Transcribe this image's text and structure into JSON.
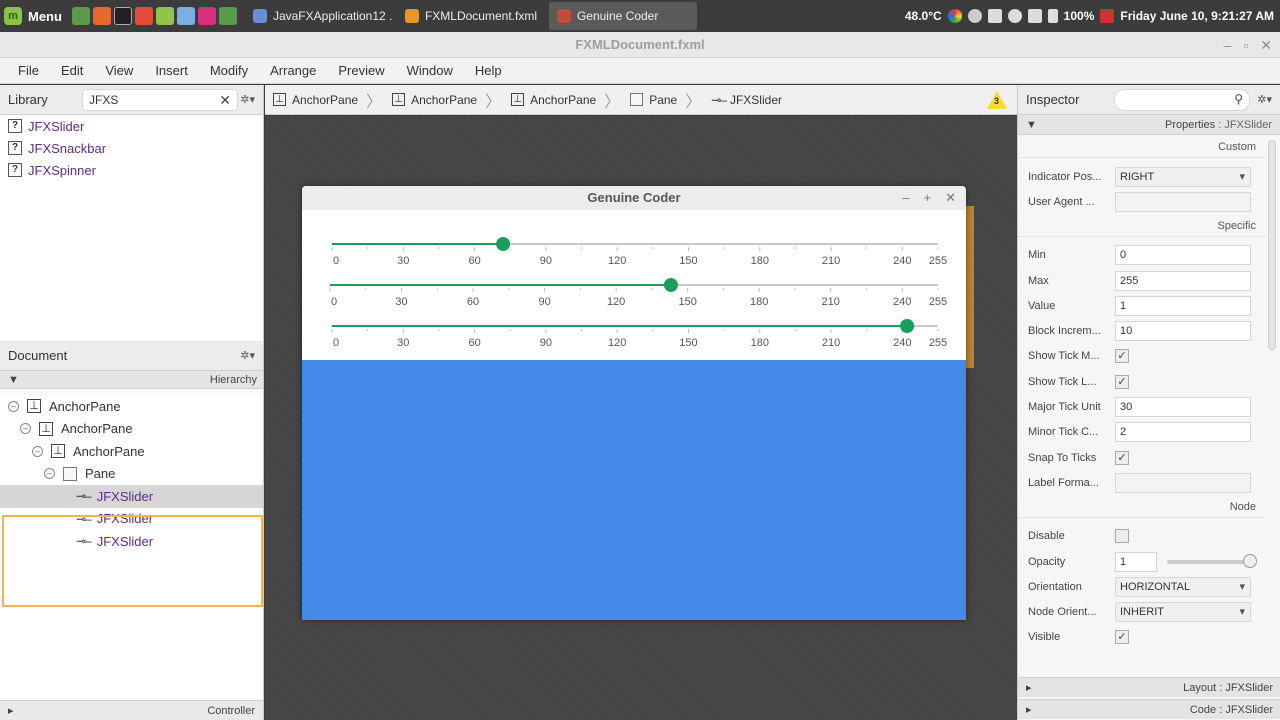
{
  "taskbar": {
    "menu_label": "Menu",
    "windows": [
      {
        "label": "JavaFXApplication12 ...",
        "color": "#6a8fd8",
        "active": false
      },
      {
        "label": "FXMLDocument.fxml",
        "color": "#e9972b",
        "active": false
      },
      {
        "label": "Genuine Coder",
        "color": "#c24c3a",
        "active": true
      }
    ],
    "temperature": "48.0°C",
    "battery": "100%",
    "clock": "Friday June 10,  9:21:27 AM"
  },
  "app": {
    "title": "FXMLDocument.fxml",
    "menus": [
      "File",
      "Edit",
      "View",
      "Insert",
      "Modify",
      "Arrange",
      "Preview",
      "Window",
      "Help"
    ]
  },
  "library": {
    "title": "Library",
    "search_value": "JFXS",
    "items": [
      "JFXSlider",
      "JFXSnackbar",
      "JFXSpinner"
    ]
  },
  "document": {
    "title": "Document",
    "hierarchy_label": "Hierarchy",
    "nodes": [
      {
        "label": "AnchorPane"
      },
      {
        "label": "AnchorPane"
      },
      {
        "label": "AnchorPane"
      },
      {
        "label": "Pane"
      },
      {
        "label": "JFXSlider"
      },
      {
        "label": "JFXSlider"
      },
      {
        "label": "JFXSlider"
      }
    ],
    "controller_label": "Controller"
  },
  "breadcrumb": [
    "AnchorPane",
    "AnchorPane",
    "AnchorPane",
    "Pane",
    "JFXSlider"
  ],
  "warning_count": "3",
  "preview": {
    "title": "Genuine Coder",
    "ticks": [
      "0",
      "30",
      "60",
      "90",
      "120",
      "150",
      "180",
      "210",
      "240",
      "255"
    ],
    "slider_values": [
      72,
      143,
      242
    ],
    "slider_min": 0,
    "slider_max": 255,
    "accent": "#1a9e5e",
    "content_color": "#4289e8"
  },
  "inspector": {
    "title": "Inspector",
    "properties_label": "Properties",
    "selected_type": "JFXSlider",
    "sections": {
      "custom": "Custom",
      "specific": "Specific",
      "node": "Node"
    },
    "custom_props": [
      {
        "label": "Indicator Pos...",
        "value": "RIGHT",
        "kind": "combo"
      },
      {
        "label": "User Agent ...",
        "value": "",
        "kind": "empty"
      }
    ],
    "specific_props": [
      {
        "label": "Min",
        "value": "0",
        "kind": "text"
      },
      {
        "label": "Max",
        "value": "255",
        "kind": "text"
      },
      {
        "label": "Value",
        "value": "1",
        "kind": "text"
      },
      {
        "label": "Block Increm...",
        "value": "10",
        "kind": "text"
      },
      {
        "label": "Show Tick M...",
        "value": "✓",
        "kind": "check"
      },
      {
        "label": "Show Tick L...",
        "value": "✓",
        "kind": "check"
      },
      {
        "label": "Major Tick Unit",
        "value": "30",
        "kind": "text"
      },
      {
        "label": "Minor Tick C...",
        "value": "2",
        "kind": "text"
      },
      {
        "label": "Snap To Ticks",
        "value": "✓",
        "kind": "check"
      },
      {
        "label": "Label Forma...",
        "value": "",
        "kind": "empty"
      }
    ],
    "node_props": [
      {
        "label": "Disable",
        "value": "",
        "kind": "check"
      },
      {
        "label": "Opacity",
        "value": "1",
        "kind": "opacity"
      },
      {
        "label": "Orientation",
        "value": "HORIZONTAL",
        "kind": "combo"
      },
      {
        "label": "Node Orient...",
        "value": "INHERIT",
        "kind": "combo"
      },
      {
        "label": "Visible",
        "value": "✓",
        "kind": "check"
      }
    ],
    "layout_label": "Layout",
    "code_label": "Code"
  }
}
